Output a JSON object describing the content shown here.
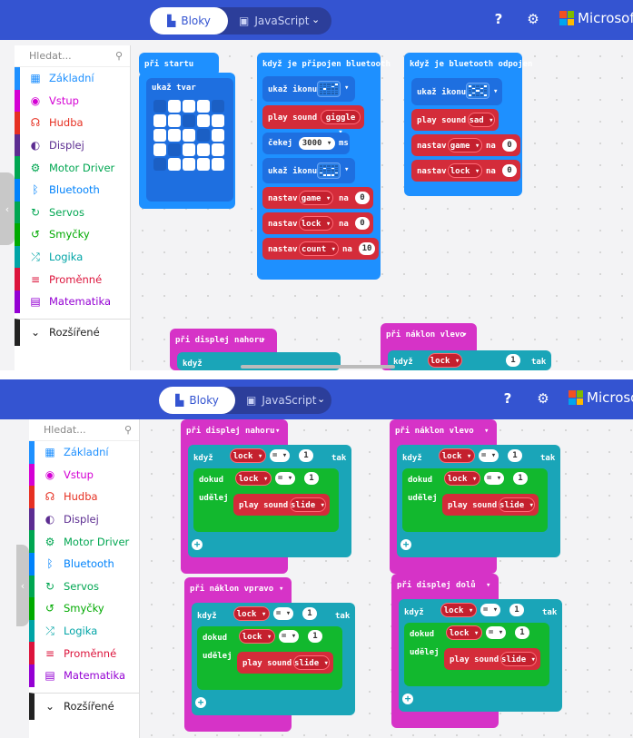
{
  "app": {
    "mode_blocks": "Bloky",
    "mode_javascript": "JavaScript",
    "brand": "Microsoft",
    "brand_partial": "Microsof"
  },
  "toolbox": {
    "search_placeholder": "Hledat...",
    "categories": [
      {
        "label": "Základní",
        "icon": "grid-icon",
        "color": "#1e90ff"
      },
      {
        "label": "Vstup",
        "icon": "target-icon",
        "color": "#d400d4"
      },
      {
        "label": "Hudba",
        "icon": "headphones-icon",
        "color": "#e63022"
      },
      {
        "label": "Displej",
        "icon": "toggle-icon",
        "color": "#5c2d91"
      },
      {
        "label": "Motor Driver",
        "icon": "bike-icon",
        "color": "#00a651"
      },
      {
        "label": "Bluetooth",
        "icon": "bluetooth-icon",
        "color": "#0082fb"
      },
      {
        "label": "Servos",
        "icon": "refresh-icon",
        "color": "#00a651"
      },
      {
        "label": "Smyčky",
        "icon": "loop-icon",
        "color": "#00aa00"
      },
      {
        "label": "Logika",
        "icon": "shuffle-icon",
        "color": "#00a4a6"
      },
      {
        "label": "Proměnné",
        "icon": "list-icon",
        "color": "#dc143c"
      },
      {
        "label": "Matematika",
        "icon": "calculator-icon",
        "color": "#9400d3"
      }
    ],
    "advanced": "Rozšířené"
  },
  "shot1": {
    "on_start": {
      "title": "při startu",
      "show_leds": "ukaž tvar",
      "leds": [
        0,
        1,
        1,
        1,
        0,
        1,
        1,
        0,
        1,
        1,
        1,
        1,
        1,
        0,
        1,
        1,
        0,
        1,
        1,
        1,
        0,
        1,
        1,
        1,
        1
      ]
    },
    "on_connected": {
      "title": "když je připojen bluetooth",
      "show_icon_1": "ukaž ikonu",
      "play_sound": "play sound",
      "sound_1": "giggle",
      "pause": "čekej",
      "pause_value": "3000",
      "pause_unit": "ms",
      "show_icon_2": "ukaž ikonu",
      "set_label": "nastav",
      "to_label": "na",
      "var_game": "game",
      "var_lock": "lock",
      "var_count": "count",
      "val_game": "0",
      "val_lock": "0",
      "val_count": "10"
    },
    "on_disconnected": {
      "title": "když je bluetooth odpojen",
      "show_icon": "ukaž ikonu",
      "play_sound": "play sound",
      "sound": "sad",
      "set_label": "nastav",
      "to_label": "na",
      "var_game": "game",
      "var_lock": "lock",
      "val_game": "0",
      "val_lock": "0"
    },
    "partial_face_up": "při  displej nahoru",
    "partial_tilt_left": "při  náklon vlevo",
    "partial_if": "když",
    "partial_then": "tak",
    "partial_var": "lock",
    "partial_val": "1"
  },
  "shot2": {
    "events": [
      {
        "title": "při  displej nahoru"
      },
      {
        "title": "při  náklon vlevo"
      },
      {
        "title": "při  náklon vpravo"
      },
      {
        "title": "při  displej dolů"
      }
    ],
    "if_label": "když",
    "then_label": "tak",
    "while_label": "dokud",
    "do_label": "udělej",
    "var": "lock",
    "op": "=",
    "val": "1",
    "play_sound": "play sound",
    "sound": "slide"
  }
}
